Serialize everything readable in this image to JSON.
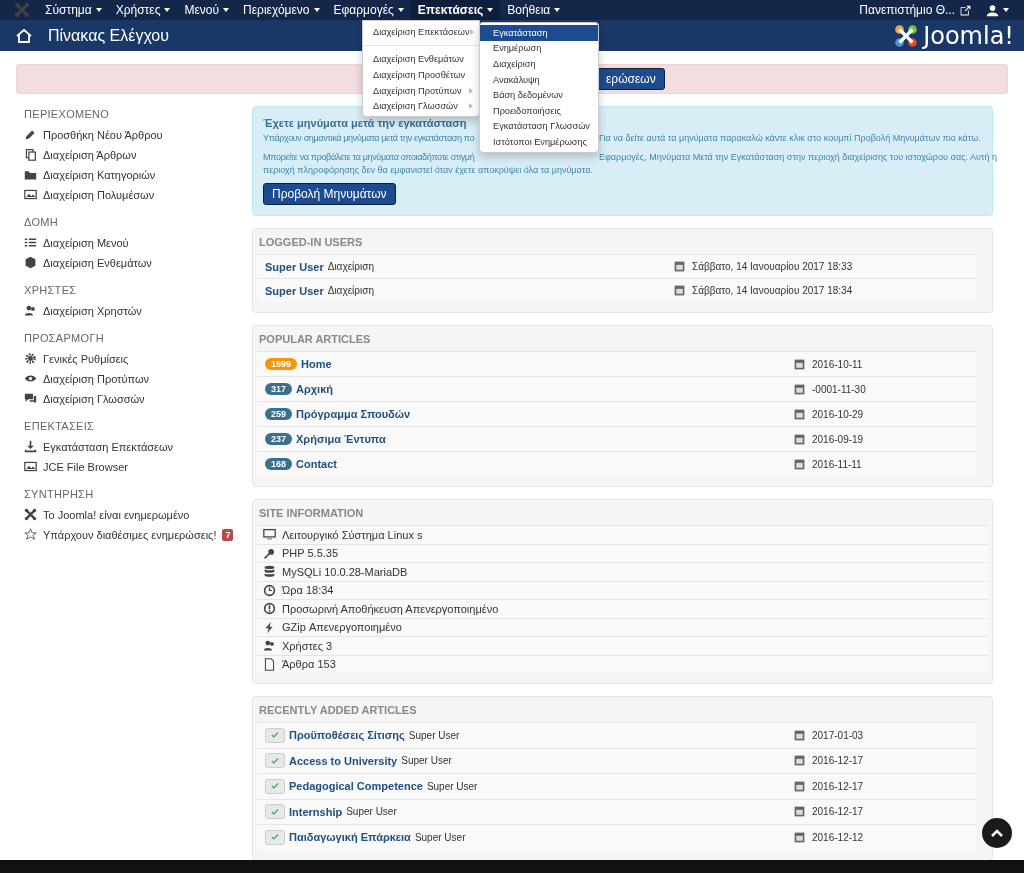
{
  "menubar": {
    "items": [
      {
        "label": "Σύστημα",
        "selected": false
      },
      {
        "label": "Χρήστες",
        "selected": false
      },
      {
        "label": "Μενού",
        "selected": false
      },
      {
        "label": "Περιεχόμενο",
        "selected": false
      },
      {
        "label": "Εφαρμογές",
        "selected": false
      },
      {
        "label": "Επεκτάσεις",
        "selected": true
      },
      {
        "label": "Βοήθεια",
        "selected": false
      }
    ],
    "site": "Πανεπιστήμιο Θ..."
  },
  "header": {
    "title": "Πίνακας Ελέγχου",
    "logo": "Joomla!"
  },
  "dropdown": {
    "items": [
      {
        "label": "Διαχείριση Επεκτάσεων",
        "submenu": true
      },
      {
        "label": "Διαχείριση Ενθεμάτων",
        "submenu": false
      },
      {
        "label": "Διαχείριση Προσθέτων",
        "submenu": false
      },
      {
        "label": "Διαχείριση Προτύπων",
        "submenu": true
      },
      {
        "label": "Διαχείριση Γλωσσών",
        "submenu": true
      }
    ]
  },
  "submenu": {
    "items": [
      {
        "label": "Εγκατάσταση",
        "selected": true
      },
      {
        "label": "Ενημέρωση",
        "selected": false
      },
      {
        "label": "Διαχείριση",
        "selected": false
      },
      {
        "label": "Ανακάλυψη",
        "selected": false
      },
      {
        "label": "Βάση δεδομένων",
        "selected": false
      },
      {
        "label": "Προειδοποιήσεις",
        "selected": false
      },
      {
        "label": "Εγκατάσταση Γλωσσών",
        "selected": false
      },
      {
        "label": "Ιστότοποι Ενημέρωσης",
        "selected": false
      }
    ]
  },
  "update_alert": {
    "button": "ερώσεων"
  },
  "sidebar": {
    "sections": [
      {
        "heading": "ΠΕΡΙΕΧΟΜΕΝΟ",
        "items": [
          {
            "label": "Προσθήκη Νέου Άρθρου"
          },
          {
            "label": "Διαχείριση Άρθρων"
          },
          {
            "label": "Διαχείριση Κατηγοριών"
          },
          {
            "label": "Διαχείριση Πολυμέσων"
          }
        ]
      },
      {
        "heading": "ΔΟΜΗ",
        "items": [
          {
            "label": "Διαχείριση Μενού"
          },
          {
            "label": "Διαχείριση Ενθεμάτων"
          }
        ]
      },
      {
        "heading": "ΧΡΗΣΤΕΣ",
        "items": [
          {
            "label": "Διαχείριση Χρηστών"
          }
        ]
      },
      {
        "heading": "ΠΡΟΣΑΡΜΟΓΗ",
        "items": [
          {
            "label": "Γενικές Ρυθμίσεις"
          },
          {
            "label": "Διαχείριση Προτύπων"
          },
          {
            "label": "Διαχείριση Γλωσσών"
          }
        ]
      },
      {
        "heading": "ΕΠΕΚΤΑΣΕΙΣ",
        "items": [
          {
            "label": "Εγκατάσταση Επεκτάσεων"
          },
          {
            "label": "JCE File Browser"
          }
        ]
      },
      {
        "heading": "ΣΥΝΤΗΡΗΣΗ",
        "items": [
          {
            "label": "Το Joomla! είναι ενημερωμένο"
          },
          {
            "label": "Υπάρχουν διαθέσιμες ενημερώσεις!",
            "badge": "7"
          }
        ]
      }
    ]
  },
  "postinstall": {
    "title": "Έχετε μηνύματα μετά την εγκατάσταση",
    "line1_start": "Υπάρχουν σημαντικά μηνύματα μετά την εγκατάσταση πο",
    "line1_end": "Για να δείτε αυτά τα μηνύματα παρακαλώ κάντε κλικ στο κουμπί Προβολή Μηνυμάτων πιο κάτω.",
    "line2_start": "Μπορείτε να προβάλετε τα μηνύματα οποιαδήποτε στιγμή",
    "line2_end": "Εφαρμογές, Μηνύματα Μετά την Εγκατάσταση στην περιοχή διαχείρισης του ιστοχώρου σας. Αυτή η",
    "line3": "περιοχή πληροφόρησης δεν θα εμφανιστεί όταν έχετε αποκρύψει όλα τα μηνύματα.",
    "button": "Προβολή Μηνυμάτων"
  },
  "logged_in_users": {
    "title": "LOGGED-IN USERS",
    "rows": [
      {
        "name": "Super User",
        "area": "Διαχείριση",
        "date": "Σάββατο, 14 Ιανουαρίου 2017 18:33"
      },
      {
        "name": "Super User",
        "area": "Διαχείριση",
        "date": "Σάββατο, 14 Ιανουαρίου 2017 18:34"
      }
    ]
  },
  "popular_articles": {
    "title": "POPULAR ARTICLES",
    "rows": [
      {
        "hits": "1599",
        "color": "#f89406",
        "title": "Home",
        "date": "2016-10-11"
      },
      {
        "hits": "317",
        "color": "#3a6f8f",
        "title": "Αρχική",
        "date": "-0001-11-30"
      },
      {
        "hits": "259",
        "color": "#3a6f8f",
        "title": "Πρόγραμμα Σπουδών",
        "date": "2016-10-29"
      },
      {
        "hits": "237",
        "color": "#3a6f8f",
        "title": "Χρήσιμα Έντυπα",
        "date": "2016-09-19"
      },
      {
        "hits": "168",
        "color": "#3a6f8f",
        "title": "Contact",
        "date": "2016-11-11"
      }
    ]
  },
  "site_information": {
    "title": "SITE INFORMATION",
    "rows": [
      "Λειτουργικό Σύστημα Linux s",
      "PHP 5.5.35",
      "MySQLi 10.0.28-MariaDB",
      "Ώρα 18:34",
      "Προσωρινή Αποθήκευση Απενεργοποιημένο",
      "GZip Απενεργοποιημένο",
      "Χρήστες 3",
      "Άρθρα 153"
    ]
  },
  "recently_added_articles": {
    "title": "RECENTLY ADDED ARTICLES",
    "rows": [
      {
        "published": true,
        "title": "Προϋποθέσεις Σίτισης",
        "author": "Super User",
        "date": "2017-01-03"
      },
      {
        "published": true,
        "title": "Access to University",
        "author": "Super User",
        "date": "2016-12-17"
      },
      {
        "published": true,
        "title": "Pedagogical Competence",
        "author": "Super User",
        "date": "2016-12-17"
      },
      {
        "published": true,
        "title": "Internship",
        "author": "Super User",
        "date": "2016-12-17"
      },
      {
        "published": true,
        "title": "Παιδαγωγική Επάρκεια",
        "author": "Super User",
        "date": "2016-12-12"
      }
    ]
  }
}
